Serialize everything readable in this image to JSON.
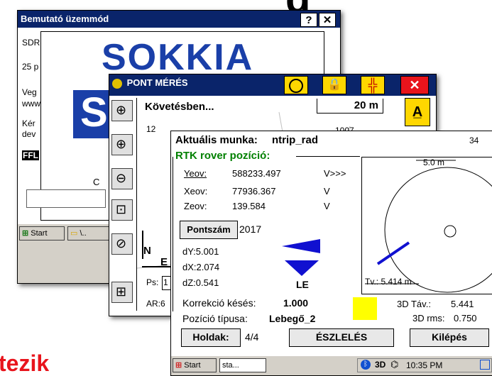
{
  "bg_window": {
    "title": "Bemutató üzemmód",
    "help_label": "?",
    "close_label": "✕",
    "logo": "SOKKIA",
    "lines": [
      "SDR",
      "25 p",
      "Veg",
      "www",
      "Kér",
      "dev",
      "FFL"
    ],
    "partial_text": "C",
    "taskbar": {
      "start_label": "Start",
      "item_label": "\\.."
    }
  },
  "mid_window": {
    "title": "PONT MÉRÉS",
    "status": "Követésben...",
    "scale": "20 m",
    "map_labels": [
      "12",
      "1007"
    ],
    "axis_n": "N",
    "axis_e": "E",
    "ps_label": "Ps:",
    "ps_value": "1",
    "ar_label": "AR:6"
  },
  "front_window": {
    "work_label": "Aktuális munka:",
    "work_name": "ntrip_rad",
    "count": "34",
    "section_title": "RTK rover pozíció:",
    "coords": [
      {
        "label": "Yeov:",
        "value": "588233.497",
        "unit": "V>>>"
      },
      {
        "label": "Xeov:",
        "value": "77936.367",
        "unit": "V"
      },
      {
        "label": "Zeov:",
        "value": "139.584",
        "unit": "V"
      }
    ],
    "pontszam_button": "Pontszám",
    "pontszam_value": "2017",
    "deltas": [
      "dY:5.001",
      "dX:2.074",
      "dZ:0.541"
    ],
    "direction_label": "LE",
    "korrekcio_label": "Korrekció késés:",
    "korrekcio_value": "1.000",
    "pozicio_label": "Pozíció típusa:",
    "pozicio_value": "Lebegő_2",
    "radar": {
      "scale_label": "5.0 m",
      "tv_label": "Tv.: 5.414 m",
      "tav_label": "3D Táv.:",
      "tav_value": "5.441",
      "rms_label": "3D rms:",
      "rms_value": "0.750"
    },
    "holdak_button": "Holdak:",
    "holdak_value": "4/4",
    "eszleles_button": "ÉSZLELÉS",
    "kilepes_button": "Kilépés",
    "status_color": "#ffff00"
  },
  "taskbar": {
    "start_label": "Start",
    "item_label": "sta...",
    "time": "10:35 PM"
  },
  "header_fragment": "g",
  "bottom_text": "tezik",
  "colors": {
    "title_bg": "#0a246a",
    "sokkia_blue": "#1a3fa8",
    "red": "#e8141c",
    "green": "#008000"
  }
}
